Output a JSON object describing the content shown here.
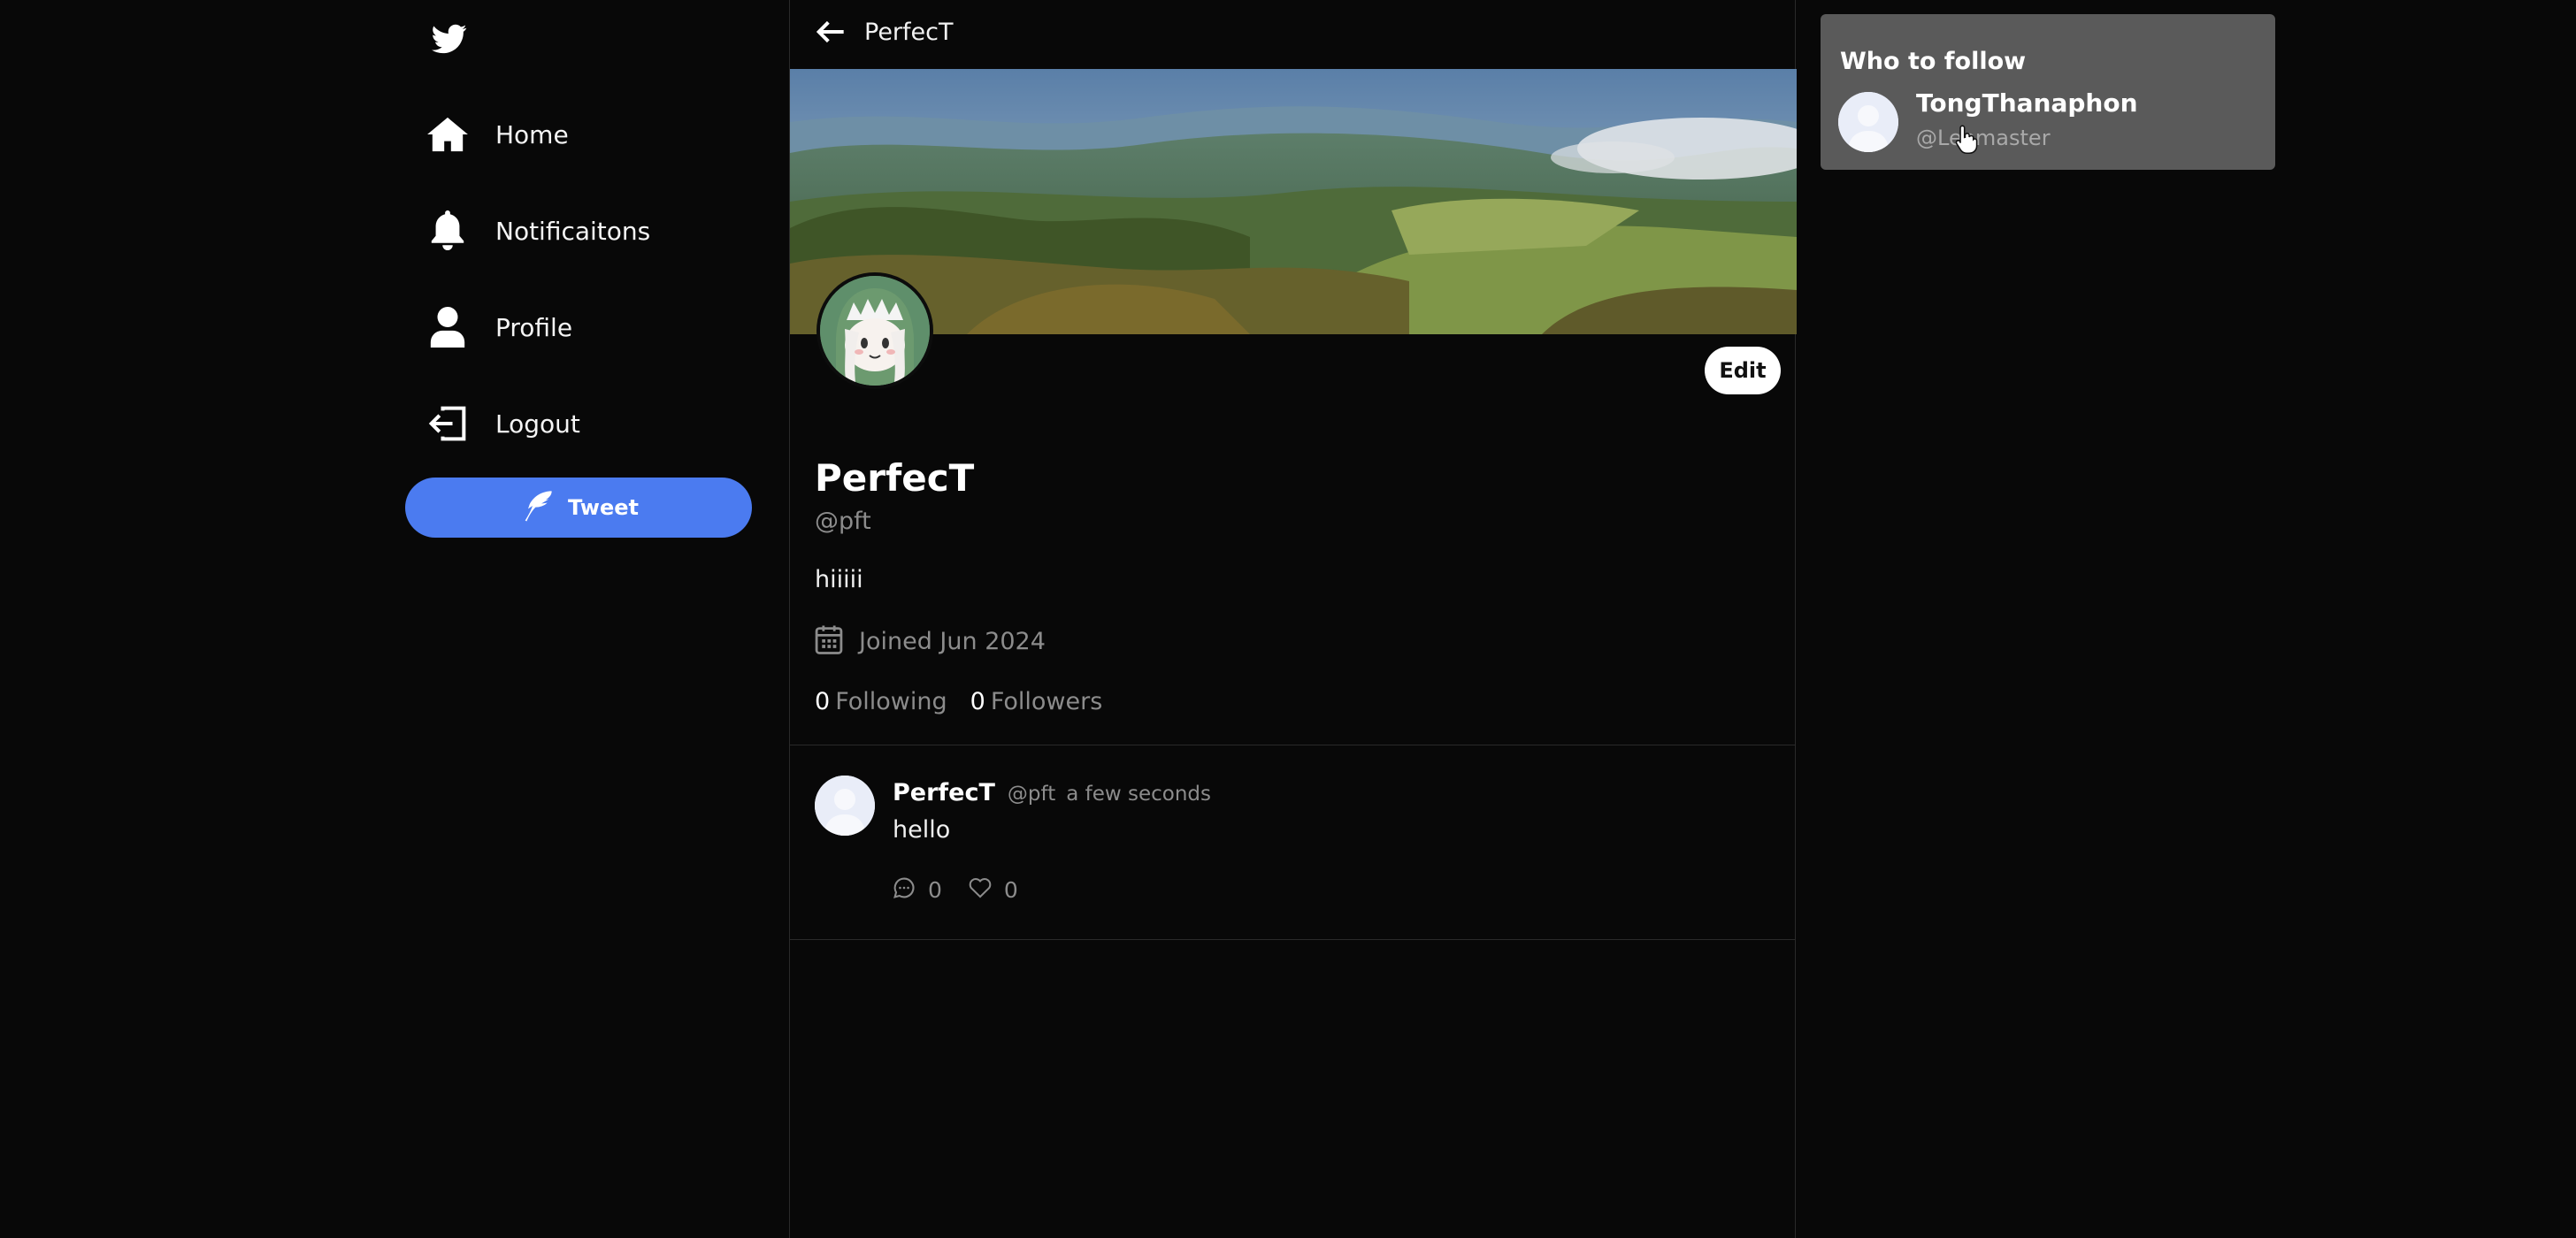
{
  "sidebar": {
    "items": [
      {
        "label": "Home",
        "icon": "home-icon"
      },
      {
        "label": "Notificaitons",
        "icon": "bell-icon"
      },
      {
        "label": "Profile",
        "icon": "user-icon"
      },
      {
        "label": "Logout",
        "icon": "logout-icon"
      }
    ],
    "tweet_button": "Tweet"
  },
  "header": {
    "title": "PerfecT"
  },
  "profile": {
    "display_name": "PerfecT",
    "handle": "@pft",
    "bio": "hiiiii",
    "joined": "Joined Jun 2024",
    "edit_label": "Edit",
    "following_count": "0",
    "following_label": "Following",
    "followers_count": "0",
    "followers_label": "Followers"
  },
  "tweets": [
    {
      "name": "PerfecT",
      "handle": "@pft",
      "time": "a few seconds",
      "text": "hello",
      "replies": "0",
      "likes": "0"
    }
  ],
  "who_to_follow": {
    "title": "Who to follow",
    "users": [
      {
        "name": "TongThanaphon",
        "handle": "@Lenmaster"
      }
    ]
  },
  "colors": {
    "background": "#080808",
    "accent": "#4b7bf0",
    "muted_text": "#8c8c8c",
    "panel": "#5a5a5a"
  }
}
